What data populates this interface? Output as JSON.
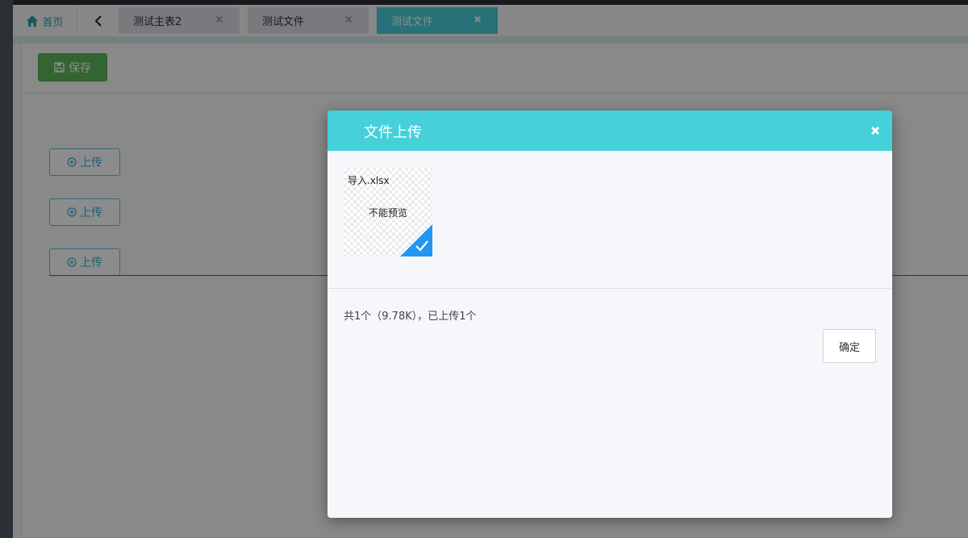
{
  "tabbar": {
    "home_label": "首页",
    "tabs": [
      {
        "label": "测试主表2",
        "active": false
      },
      {
        "label": "测试文件",
        "active": false
      },
      {
        "label": "测试文件",
        "active": true
      }
    ]
  },
  "toolbar": {
    "save_label": "保存"
  },
  "uploads": [
    {
      "label": "上传"
    },
    {
      "label": "上传"
    },
    {
      "label": "上传"
    }
  ],
  "dialog": {
    "title": "文件上传",
    "file": {
      "name": "导入.xlsx",
      "preview_text": "不能预览"
    },
    "summary": "共1个（9.78K），已上传1个",
    "confirm_label": "确定"
  },
  "colors": {
    "accent": "#46d0da",
    "save": "#5cb85c",
    "upload_border": "#5bc0de",
    "check": "#2196f3"
  },
  "icons": {
    "home": "home-icon",
    "back": "chevron-left-icon",
    "close": "close-icon",
    "save": "floppy-disk-icon",
    "upload": "plus-circle-icon",
    "check": "check-icon"
  }
}
